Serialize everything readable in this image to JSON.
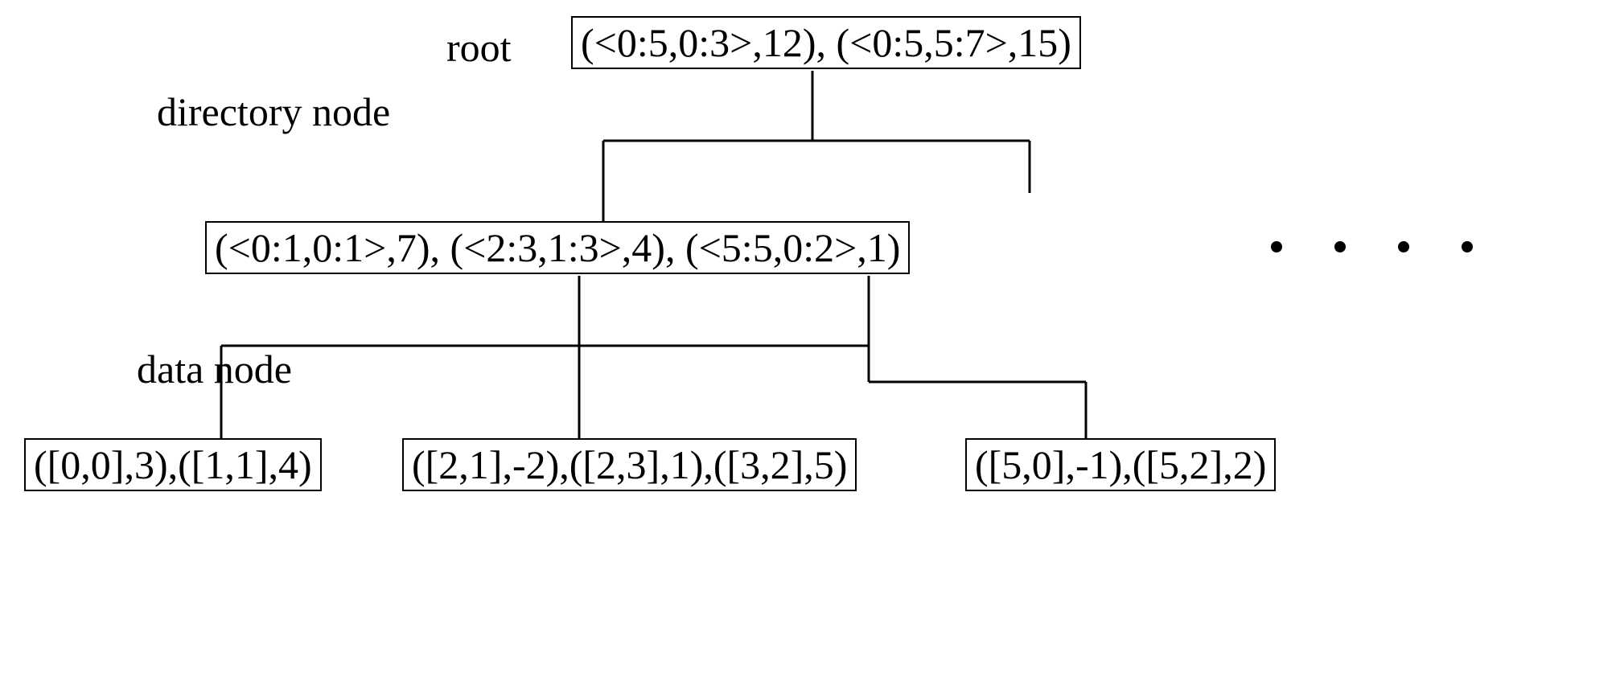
{
  "labels": {
    "root": "root",
    "directory_node": "directory node",
    "data_node": "data node"
  },
  "tree": {
    "root": {
      "content": "(<0:5,0:3>,12), (<0:5,5:7>,15)"
    },
    "directory": {
      "content": "(<0:1,0:1>,7), (<2:3,1:3>,4), (<5:5,0:2>,1)"
    },
    "data_nodes": [
      {
        "content": "([0,0],3),([1,1],4)"
      },
      {
        "content": "([2,1],-2),([2,3],1),([3,2],5)"
      },
      {
        "content": "([5,0],-1),([5,2],2)"
      }
    ]
  },
  "dots_count": 4
}
